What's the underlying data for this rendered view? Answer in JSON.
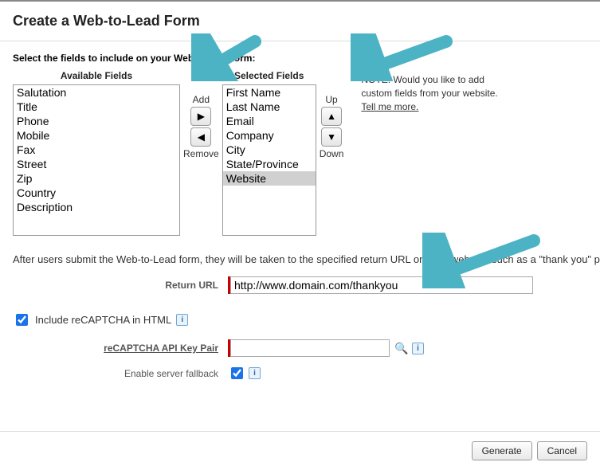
{
  "title": "Create a Web-to-Lead Form",
  "instruction": "Select the fields to include on your Web-to-lead form:",
  "available": {
    "header": "Available Fields",
    "items": [
      "Salutation",
      "Title",
      "Phone",
      "Mobile",
      "Fax",
      "Street",
      "Zip",
      "Country",
      "Description"
    ]
  },
  "selected": {
    "header": "Selected Fields",
    "items": [
      "First Name",
      "Last Name",
      "Email",
      "Company",
      "City",
      "State/Province",
      "Website"
    ],
    "highlight_index": 6
  },
  "controls": {
    "add": "Add",
    "remove": "Remove",
    "up": "Up",
    "down": "Down"
  },
  "note": {
    "text": "NOTE: Would you like to add custom fields from your website. ",
    "link": "Tell me more."
  },
  "after_submit_text": "After users submit the Web-to-Lead form, they will be taken to the specified return URL on your website, such as a \"thank you\" page.",
  "return_url": {
    "label": "Return URL",
    "value": "http://www.domain.com/thankyou"
  },
  "recaptcha": {
    "include_label": "Include reCAPTCHA in HTML",
    "include_checked": true,
    "keypair_label": "reCAPTCHA API Key Pair",
    "keypair_value": "",
    "fallback_label": "Enable server fallback",
    "fallback_checked": true
  },
  "footer": {
    "generate": "Generate",
    "cancel": "Cancel"
  }
}
